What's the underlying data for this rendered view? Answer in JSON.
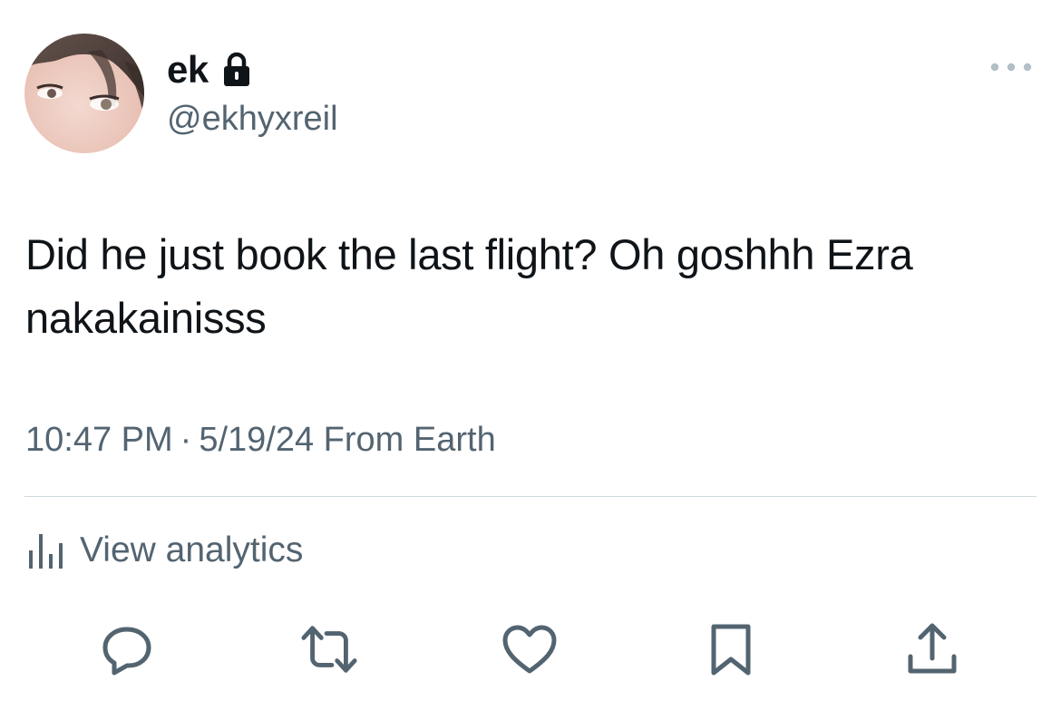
{
  "author": {
    "display_name": "ek",
    "handle": "@ekhyxreil",
    "protected": true
  },
  "tweet": {
    "text": "Did he just book the last flight? Oh goshhh Ezra nakakainisss",
    "time": "10:47 PM",
    "separator": "·",
    "date": "5/19/24",
    "source": "From Earth"
  },
  "analytics": {
    "label": "View analytics"
  },
  "actions": [
    {
      "icon": "reply-icon"
    },
    {
      "icon": "retweet-icon"
    },
    {
      "icon": "like-icon"
    },
    {
      "icon": "bookmark-icon"
    },
    {
      "icon": "share-icon"
    }
  ],
  "colors": {
    "text_primary": "#0f1419",
    "text_secondary": "#536471",
    "divider": "#cfd9de"
  }
}
